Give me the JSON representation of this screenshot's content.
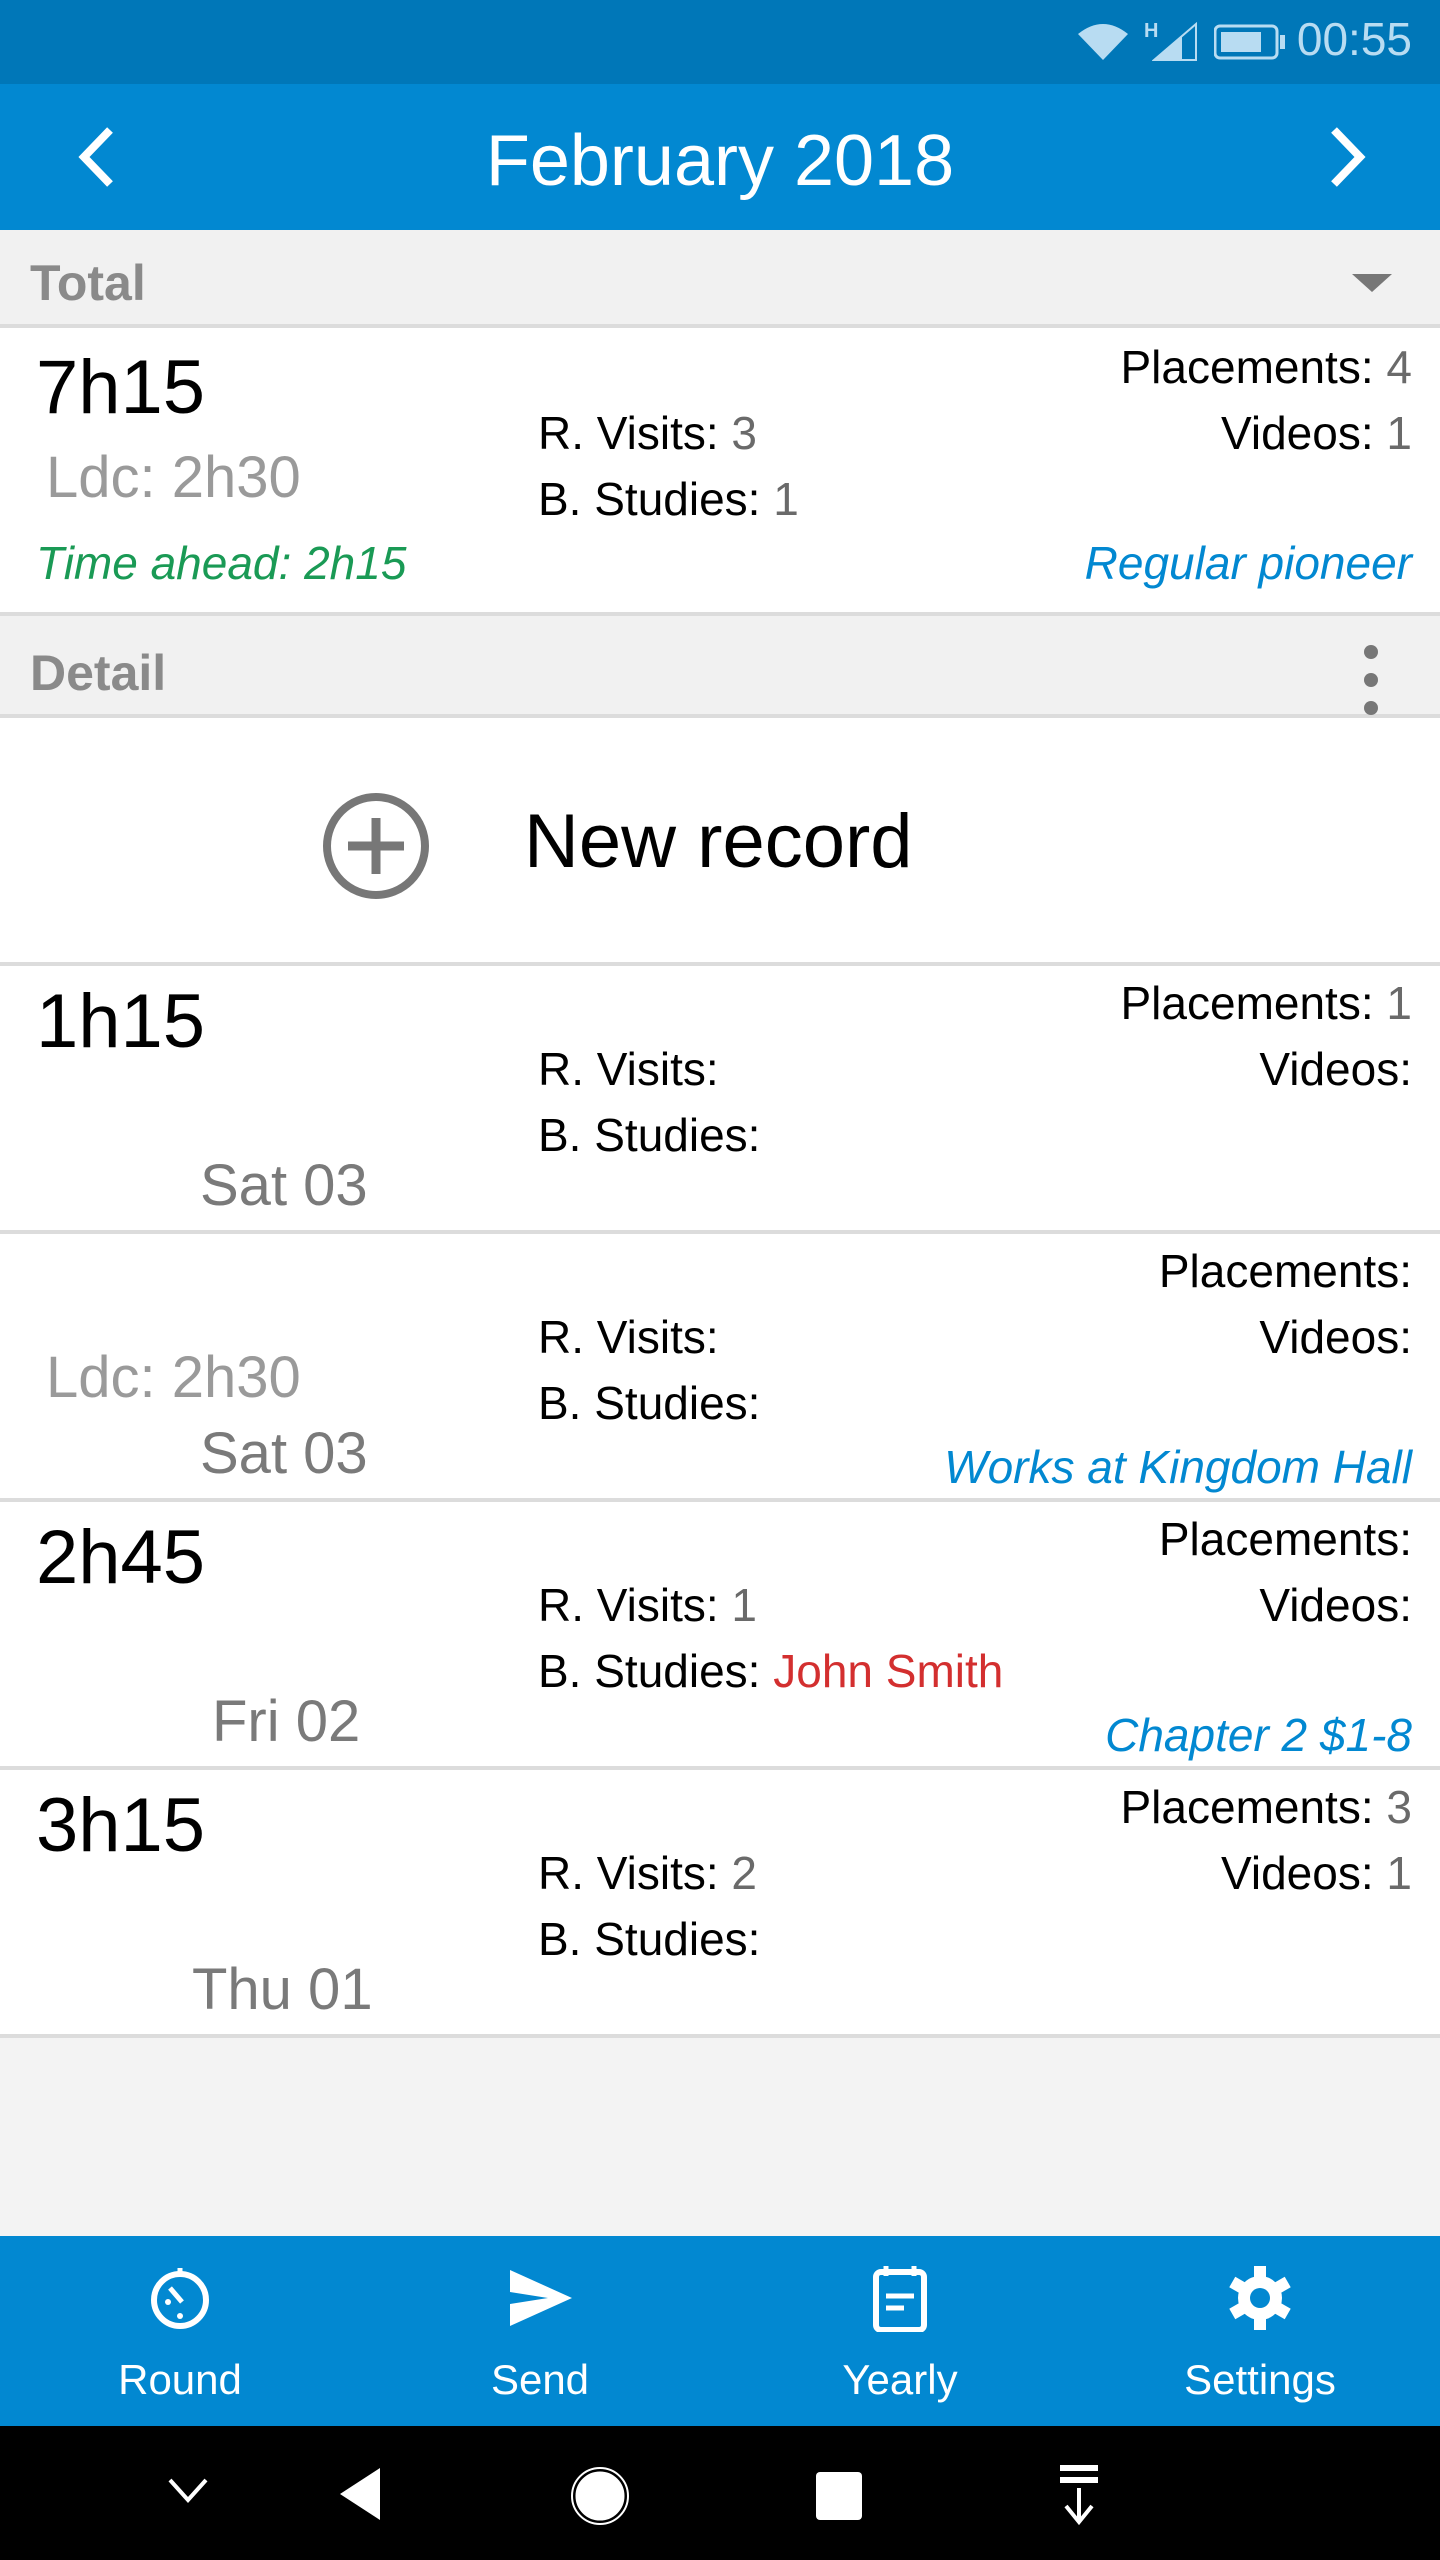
{
  "status_bar": {
    "time": "00:55",
    "network_type": "H",
    "icons": [
      "wifi-icon",
      "signal-icon",
      "battery-icon"
    ]
  },
  "app_bar": {
    "title": "February 2018",
    "prev_icon": "chevron-left-icon",
    "next_icon": "chevron-right-icon"
  },
  "total_section": {
    "header": "Total",
    "dropdown_icon": "triangle-down-icon",
    "hours": "7h15",
    "ldc": "Ldc: 2h30",
    "time_ahead": "Time ahead: 2h15",
    "r_visits_label": "R. Visits:",
    "r_visits_value": "3",
    "b_studies_label": "B. Studies:",
    "b_studies_value": "1",
    "placements_label": "Placements:",
    "placements_value": "4",
    "videos_label": "Videos:",
    "videos_value": "1",
    "status": "Regular pioneer"
  },
  "detail_section": {
    "header": "Detail",
    "menu_icon": "more-vert-icon"
  },
  "new_record": {
    "label": "New record",
    "icon": "add-circle-icon"
  },
  "records": [
    {
      "hours": "1h15",
      "ldc": "",
      "date": "Sat 03",
      "r_visits_label": "R. Visits:",
      "r_visits_value": "",
      "b_studies_label": "B. Studies:",
      "b_studies_value": "",
      "placements_label": "Placements:",
      "placements_value": "1",
      "videos_label": "Videos:",
      "videos_value": "",
      "note": ""
    },
    {
      "hours": "",
      "ldc": "Ldc: 2h30",
      "date": "Sat 03",
      "r_visits_label": "R. Visits:",
      "r_visits_value": "",
      "b_studies_label": "B. Studies:",
      "b_studies_value": "",
      "placements_label": "Placements:",
      "placements_value": "",
      "videos_label": "Videos:",
      "videos_value": "",
      "note": "Works at Kingdom Hall"
    },
    {
      "hours": "2h45",
      "ldc": "",
      "date": "Fri 02",
      "r_visits_label": "R. Visits:",
      "r_visits_value": "1",
      "b_studies_label": "B. Studies:",
      "b_studies_value": "John Smith",
      "placements_label": "Placements:",
      "placements_value": "",
      "videos_label": "Videos:",
      "videos_value": "",
      "note": "Chapter 2 $1-8"
    },
    {
      "hours": "3h15",
      "ldc": "",
      "date": "Thu 01",
      "r_visits_label": "R. Visits:",
      "r_visits_value": "2",
      "b_studies_label": "B. Studies:",
      "b_studies_value": "",
      "placements_label": "Placements:",
      "placements_value": "3",
      "videos_label": "Videos:",
      "videos_value": "1",
      "note": ""
    }
  ],
  "bottom_nav": [
    {
      "label": "Round",
      "icon": "timer-icon"
    },
    {
      "label": "Send",
      "icon": "send-icon"
    },
    {
      "label": "Yearly",
      "icon": "calendar-icon"
    },
    {
      "label": "Settings",
      "icon": "gear-icon"
    }
  ],
  "system_nav": [
    "collapse-icon",
    "back-icon",
    "home-icon",
    "recents-icon",
    "notification-pull-icon"
  ],
  "colors": {
    "primary": "#0288d1",
    "status_bar": "#0077b8",
    "green": "#1a9a55",
    "red": "#d32f2f"
  }
}
